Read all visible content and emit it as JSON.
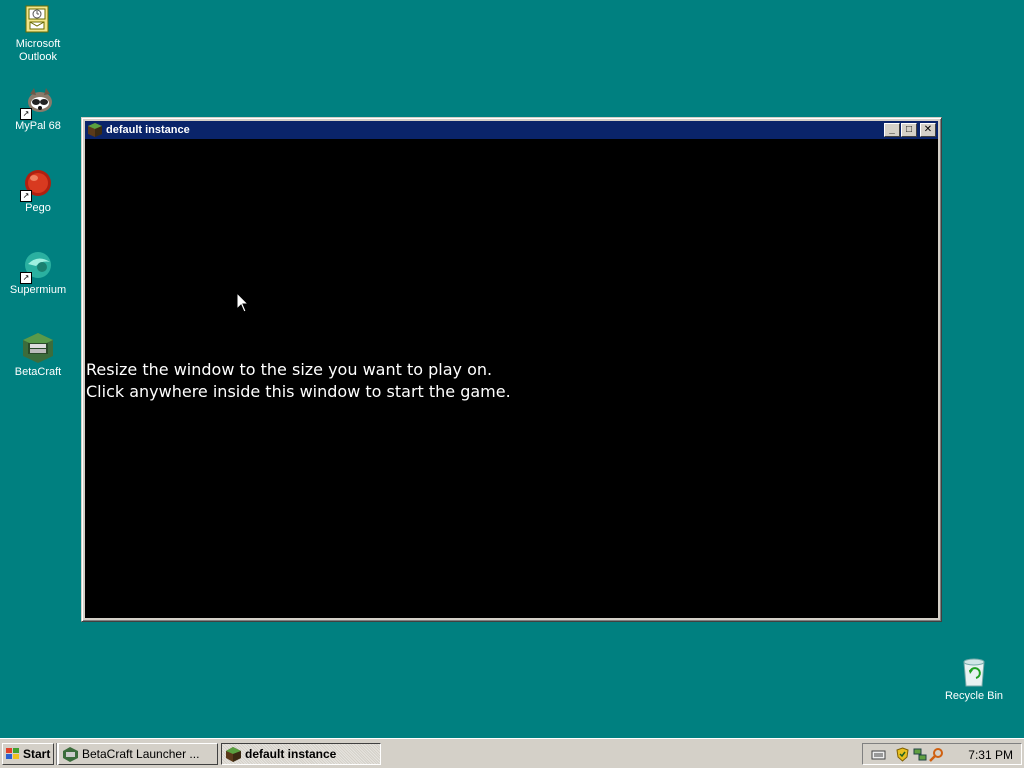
{
  "desktop": {
    "icons": [
      {
        "label_line1": "Microsoft",
        "label_line2": "Outlook",
        "icon": "outlook-icon"
      },
      {
        "label_line1": "MyPal 68",
        "label_line2": "",
        "icon": "mypal-icon"
      },
      {
        "label_line1": "Pego",
        "label_line2": "",
        "icon": "pego-icon"
      },
      {
        "label_line1": "Supermium",
        "label_line2": "",
        "icon": "supermium-icon"
      },
      {
        "label_line1": "BetaCraft",
        "label_line2": "",
        "icon": "betacraft-icon"
      }
    ],
    "recycle_bin": {
      "label": "Recycle Bin",
      "icon": "recycle-bin-icon"
    },
    "background_color": "#008080"
  },
  "window": {
    "title": "default instance",
    "minimize_glyph": "_",
    "maximize_glyph": "□",
    "close_glyph": "✕",
    "message_line1": "Resize the window to the size you want to play on.",
    "message_line2": "Click anywhere inside this window to start the game.",
    "titlebar_color": "#0a246a"
  },
  "taskbar": {
    "start_label": "Start",
    "buttons": [
      {
        "label": "BetaCraft Launcher ...",
        "active": false
      },
      {
        "label": "default instance",
        "active": true
      }
    ],
    "tray_icons": [
      "keyboard-icon",
      "shield-icon",
      "network-icon",
      "search-icon"
    ],
    "clock": "7:31 PM"
  }
}
